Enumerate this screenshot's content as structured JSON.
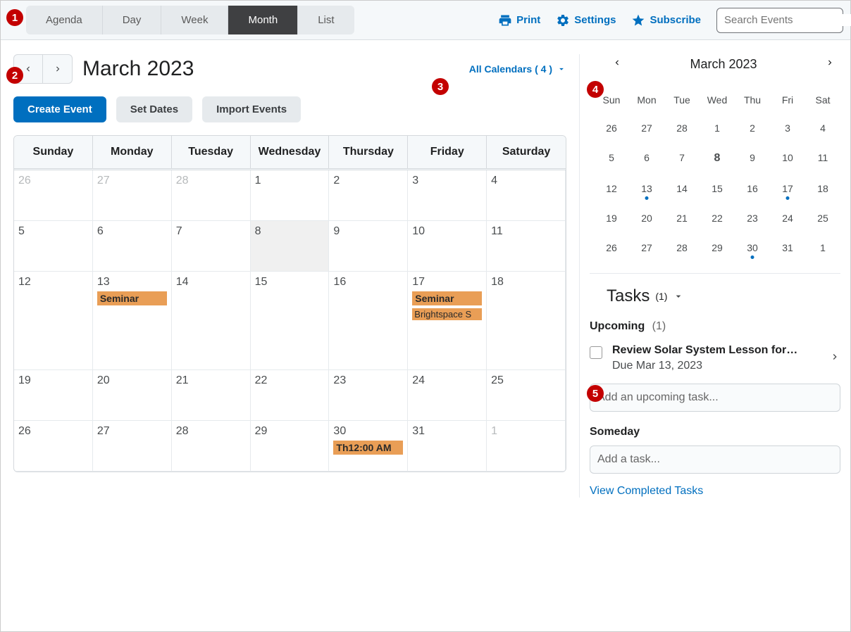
{
  "toolbar": {
    "tabs": [
      "Agenda",
      "Day",
      "Week",
      "Month",
      "List"
    ],
    "activeTab": "Month",
    "print": "Print",
    "settings": "Settings",
    "subscribe": "Subscribe",
    "searchPlaceholder": "Search Events"
  },
  "calendar": {
    "title": "March 2023",
    "allCalendars": "All Calendars ( 4 )",
    "createEvent": "Create Event",
    "setDates": "Set Dates",
    "importEvents": "Import Events",
    "days": [
      "Sunday",
      "Monday",
      "Tuesday",
      "Wednesday",
      "Thursday",
      "Friday",
      "Saturday"
    ],
    "weeks": [
      [
        {
          "n": "26",
          "other": true
        },
        {
          "n": "27",
          "other": true
        },
        {
          "n": "28",
          "other": true
        },
        {
          "n": "1"
        },
        {
          "n": "2"
        },
        {
          "n": "3"
        },
        {
          "n": "4"
        }
      ],
      [
        {
          "n": "5"
        },
        {
          "n": "6"
        },
        {
          "n": "7"
        },
        {
          "n": "8",
          "today": true
        },
        {
          "n": "9"
        },
        {
          "n": "10"
        },
        {
          "n": "11"
        }
      ],
      [
        {
          "n": "12"
        },
        {
          "n": "13",
          "events": [
            "Seminar"
          ]
        },
        {
          "n": "14"
        },
        {
          "n": "15"
        },
        {
          "n": "16"
        },
        {
          "n": "17",
          "events": [
            "Seminar",
            "Brightspace S"
          ]
        },
        {
          "n": "18"
        }
      ],
      [
        {
          "n": "19"
        },
        {
          "n": "20"
        },
        {
          "n": "21"
        },
        {
          "n": "22"
        },
        {
          "n": "23"
        },
        {
          "n": "24"
        },
        {
          "n": "25"
        }
      ],
      [
        {
          "n": "26"
        },
        {
          "n": "27"
        },
        {
          "n": "28"
        },
        {
          "n": "29"
        },
        {
          "n": "30",
          "events": [
            "Th12:00 AM"
          ]
        },
        {
          "n": "31"
        },
        {
          "n": "1",
          "other": true
        }
      ]
    ]
  },
  "mini": {
    "title": "March 2023",
    "days": [
      "Sun",
      "Mon",
      "Tue",
      "Wed",
      "Thu",
      "Fri",
      "Sat"
    ],
    "rows": [
      [
        {
          "n": "26"
        },
        {
          "n": "27"
        },
        {
          "n": "28"
        },
        {
          "n": "1"
        },
        {
          "n": "2"
        },
        {
          "n": "3"
        },
        {
          "n": "4"
        }
      ],
      [
        {
          "n": "5"
        },
        {
          "n": "6"
        },
        {
          "n": "7"
        },
        {
          "n": "8",
          "bold": true
        },
        {
          "n": "9"
        },
        {
          "n": "10"
        },
        {
          "n": "11"
        }
      ],
      [
        {
          "n": "12"
        },
        {
          "n": "13",
          "dot": true
        },
        {
          "n": "14"
        },
        {
          "n": "15"
        },
        {
          "n": "16"
        },
        {
          "n": "17",
          "dot": true
        },
        {
          "n": "18"
        }
      ],
      [
        {
          "n": "19"
        },
        {
          "n": "20"
        },
        {
          "n": "21"
        },
        {
          "n": "22"
        },
        {
          "n": "23"
        },
        {
          "n": "24"
        },
        {
          "n": "25"
        }
      ],
      [
        {
          "n": "26"
        },
        {
          "n": "27"
        },
        {
          "n": "28"
        },
        {
          "n": "29"
        },
        {
          "n": "30",
          "dot": true
        },
        {
          "n": "31"
        },
        {
          "n": "1"
        }
      ]
    ]
  },
  "tasks": {
    "title": "Tasks",
    "count": "(1)",
    "upcoming": "Upcoming",
    "upcomingCount": "(1)",
    "item": {
      "name": "Review Solar System Lesson for…",
      "due": "Due Mar 13, 2023"
    },
    "addUpcoming": "Add an upcoming task...",
    "someday": "Someday",
    "addTask": "Add a task...",
    "viewCompleted": "View Completed Tasks"
  },
  "markers": [
    "1",
    "2",
    "3",
    "4",
    "5"
  ]
}
